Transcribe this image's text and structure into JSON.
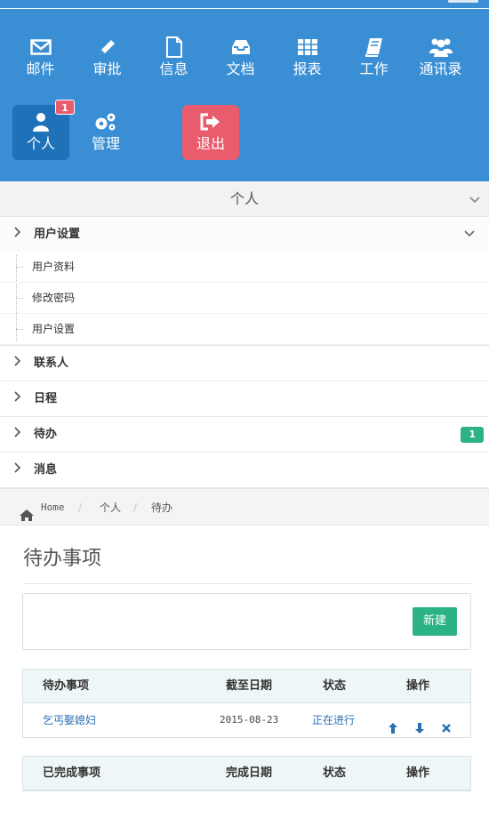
{
  "nav": {
    "row1": [
      {
        "label": "邮件",
        "icon": "mail-icon"
      },
      {
        "label": "审批",
        "icon": "pencil-icon"
      },
      {
        "label": "信息",
        "icon": "document-icon"
      },
      {
        "label": "文档",
        "icon": "inbox-icon"
      },
      {
        "label": "报表",
        "icon": "table-icon"
      },
      {
        "label": "工作",
        "icon": "book-icon"
      },
      {
        "label": "通讯录",
        "icon": "users-icon"
      }
    ],
    "row2": [
      {
        "label": "个人",
        "icon": "user-icon",
        "badge": "1"
      },
      {
        "label": "管理",
        "icon": "cogs-icon"
      },
      {
        "label": "退出",
        "icon": "sign-out-icon"
      }
    ]
  },
  "section": {
    "title": "个人"
  },
  "menu": {
    "user_settings": "用户设置",
    "sub": [
      "用户资料",
      "修改密码",
      "用户设置"
    ],
    "contacts": "联系人",
    "schedule": "日程",
    "todo": "待办",
    "todo_count": "1",
    "messages": "消息"
  },
  "breadcrumb": {
    "home": "Home",
    "level1": "个人",
    "level2": "待办"
  },
  "page": {
    "title": "待办事项",
    "new_button": "新建"
  },
  "todo_table": {
    "headers": [
      "待办事项",
      "截至日期",
      "状态",
      "操作"
    ],
    "rows": [
      {
        "item": "乞丐娶媳妇",
        "date": "2015-08-23",
        "status": "正在进行"
      }
    ]
  },
  "done_table": {
    "headers": [
      "已完成事项",
      "完成日期",
      "状态",
      "操作"
    ]
  },
  "colors": {
    "primary": "#3a8ed4",
    "active_tile": "#1f71b8",
    "danger": "#e95c6e",
    "success": "#2bb383",
    "link": "#2a6eb3"
  }
}
